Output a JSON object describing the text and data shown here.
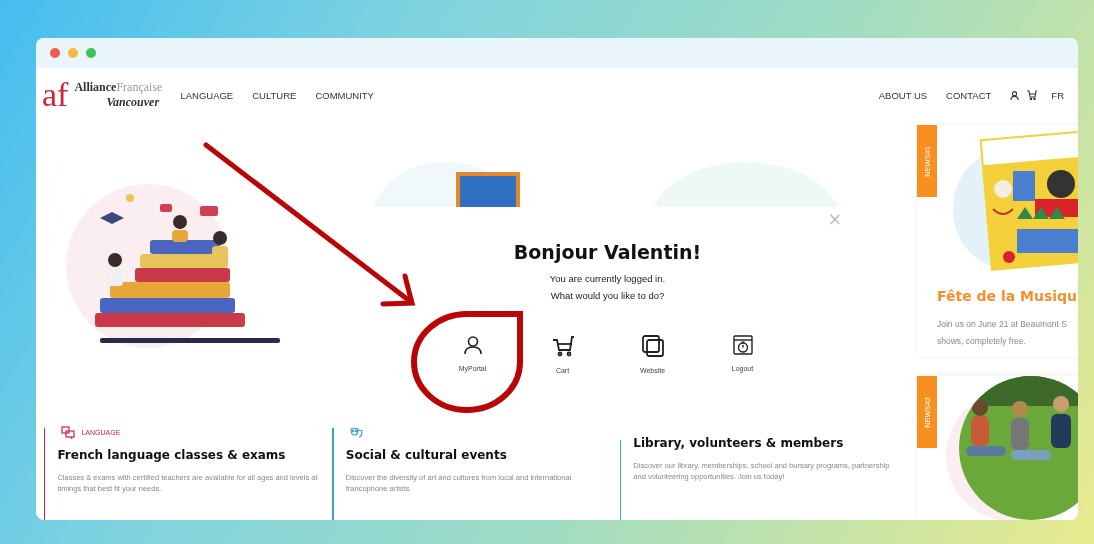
{
  "browser": {
    "dots": [
      {
        "color": "#f25b52"
      },
      {
        "color": "#f6b93b"
      },
      {
        "color": "#3cc45a"
      }
    ]
  },
  "header": {
    "logo": {
      "mark": "af",
      "name_1": "Alliance",
      "name_2": "Française",
      "city": "Vancouver"
    },
    "nav_left": [
      "LANGUAGE",
      "CULTURE",
      "COMMUNITY"
    ],
    "nav_right": [
      "ABOUT US",
      "CONTACT"
    ],
    "language": "FR"
  },
  "modal": {
    "close": "×",
    "title": "Bonjour Valentin!",
    "lines": [
      "You are currently logged in.",
      "What would you like to do?"
    ],
    "actions": [
      {
        "kind": "user",
        "label": "MyPortal"
      },
      {
        "kind": "cart",
        "label": "Cart"
      },
      {
        "kind": "website",
        "label": "Website"
      },
      {
        "kind": "logout",
        "label": "Logout"
      }
    ]
  },
  "cards": [
    {
      "kind": "language",
      "tag": "LANGUAGE",
      "color": "#c8283c",
      "title": "French language classes & exams",
      "text": "Classes & exams with certified teachers are available for all ages and levels at timings that best fit your needs."
    },
    {
      "kind": "culture",
      "color": "#3a9fc8",
      "title": "Social & cultural events",
      "text": "Discover the diversity of art and cultures from local and international francophone artists."
    },
    {
      "kind": "community",
      "color": "#3ab8a0",
      "title": "Library, volunteers & members",
      "text": "Discover our library, memberships, school and bursary programs, partnership and volunteering opportunities. Join us today!"
    }
  ],
  "news": [
    {
      "tag": "NEWS#1",
      "title": "Fête de la Musiqu",
      "lines": [
        "Join us on June 21 at Beaumont S",
        "shows, completely free."
      ]
    },
    {
      "tag": "NEWS#2"
    }
  ]
}
